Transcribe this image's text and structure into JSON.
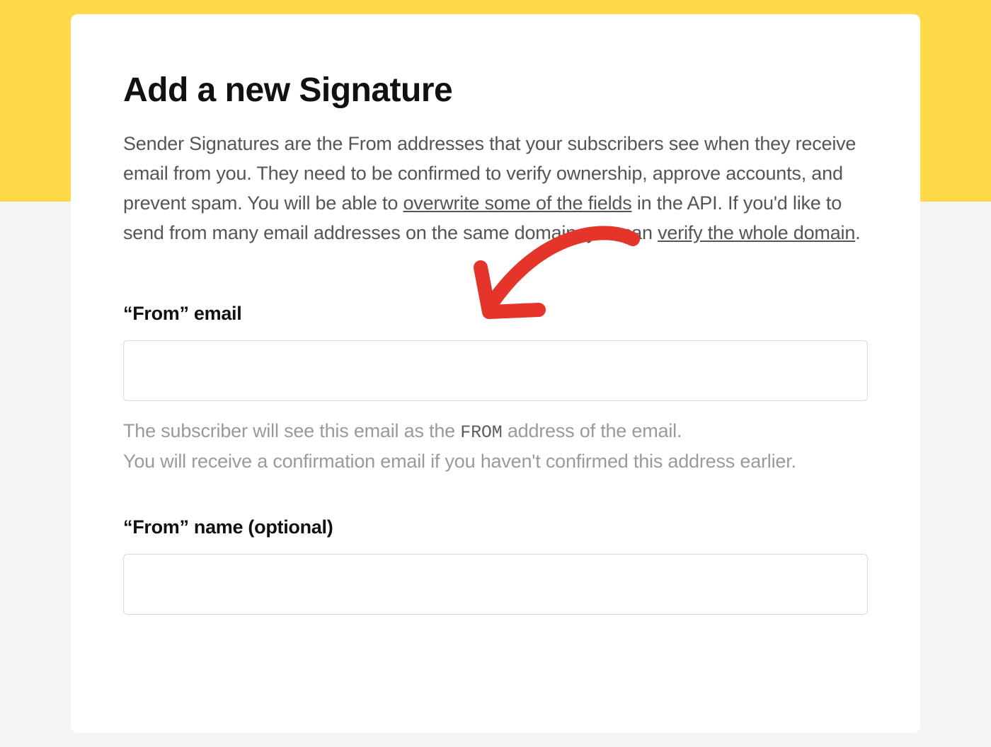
{
  "page": {
    "title": "Add a new Signature",
    "description_pre": "Sender Signatures are the From addresses that your subscribers see when they receive email from you. They need to be confirmed to verify ownership, approve accounts, and prevent spam. You will be able to ",
    "link_overwrite": "overwrite some of the fields",
    "description_mid": " in the API. If you'd like to send from many email addresses on the same domain, you can ",
    "link_verify": "verify the whole domain",
    "description_end": "."
  },
  "fields": {
    "from_email": {
      "label": "“From” email",
      "value": "",
      "help_pre": "The subscriber will see this email as the ",
      "help_mono": "FROM",
      "help_post": " address of the email.",
      "help_line2": "You will receive a confirmation email if you haven't confirmed this address earlier."
    },
    "from_name": {
      "label": "“From” name (optional)",
      "value": ""
    }
  }
}
